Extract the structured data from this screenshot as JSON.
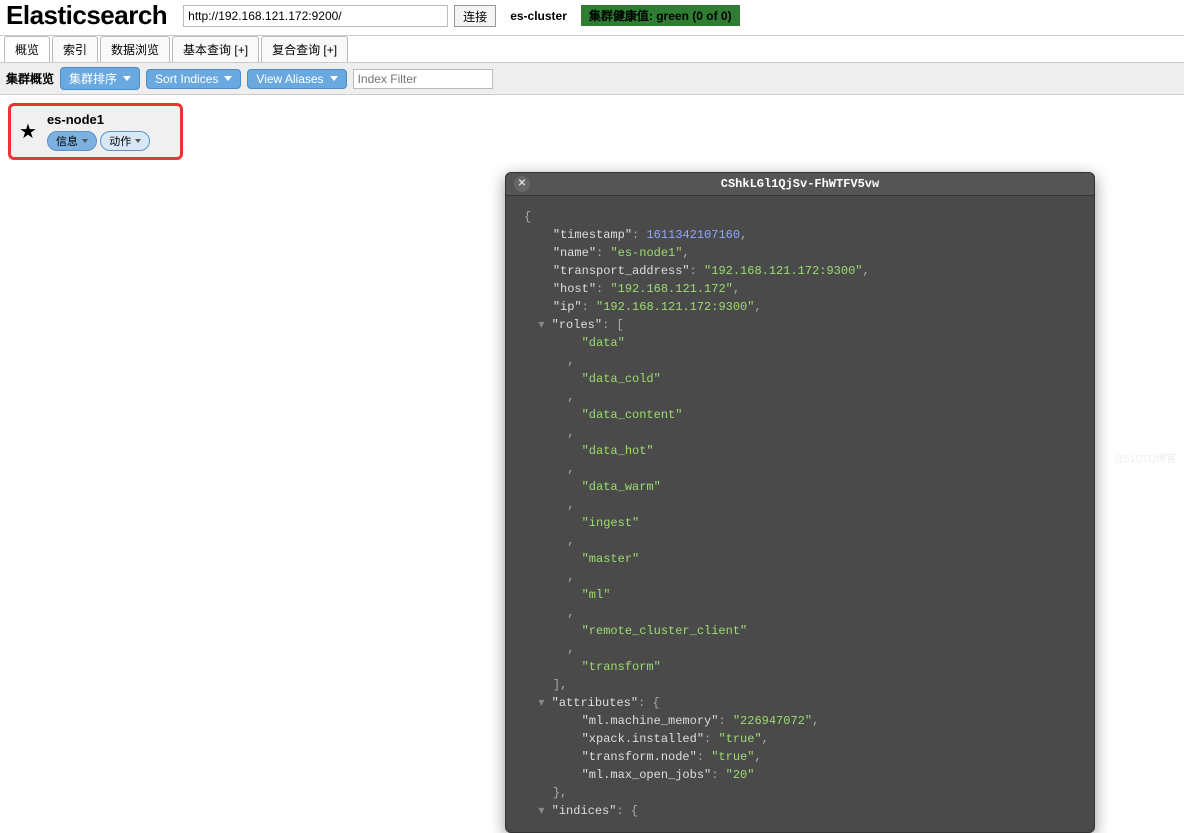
{
  "logo": "Elasticsearch",
  "url_value": "http://192.168.121.172:9200/",
  "connect_label": "连接",
  "cluster_name": "es-cluster",
  "health_text": "集群健康值: green (0 of 0)",
  "tabs": {
    "overview": "概览",
    "indices": "索引",
    "browse": "数据浏览",
    "basic": "基本查询 [+]",
    "compound": "复合查询 [+]"
  },
  "toolbar": {
    "label": "集群概览",
    "sort_cluster": "集群排序",
    "sort_indices": "Sort Indices",
    "view_aliases": "View Aliases",
    "filter_placeholder": "Index Filter"
  },
  "node": {
    "name": "es-node1",
    "info": "信息",
    "actions": "动作"
  },
  "panel": {
    "title": "CShkLGl1QjSv-FhWTFV5vw",
    "json": {
      "timestamp": 1611342107160,
      "name": "es-node1",
      "transport_address": "192.168.121.172:9300",
      "host": "192.168.121.172",
      "ip": "192.168.121.172:9300",
      "roles": [
        "data",
        "data_cold",
        "data_content",
        "data_hot",
        "data_warm",
        "ingest",
        "master",
        "ml",
        "remote_cluster_client",
        "transform"
      ],
      "attributes": {
        "ml.machine_memory": "226947072",
        "xpack.installed": "true",
        "transform.node": "true",
        "ml.max_open_jobs": "20"
      },
      "indices_label": "indices"
    }
  },
  "watermark": "@51CTO博客"
}
